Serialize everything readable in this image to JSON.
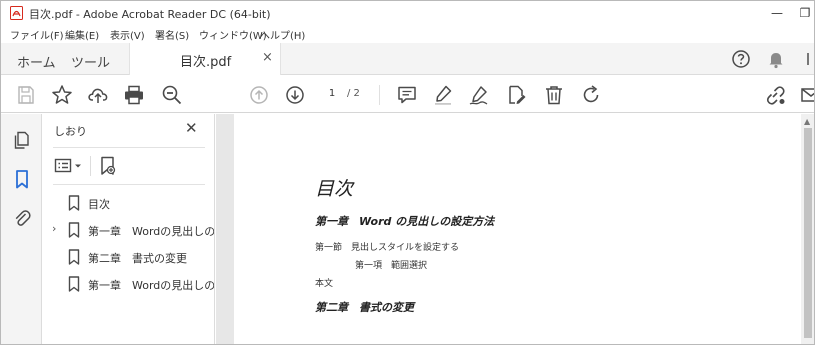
{
  "window": {
    "title": "目次.pdf - Adobe Acrobat Reader DC (64-bit)",
    "minimize_glyph": "—",
    "restore_glyph": "❐"
  },
  "menu": [
    "ファイル(F)",
    "編集(E)",
    "表示(V)",
    "署名(S)",
    "ウィンドウ(W)",
    "ヘルプ(H)"
  ],
  "tabs": {
    "home": "ホーム",
    "tools": "ツール",
    "document": "目次.pdf",
    "close_glyph": "×"
  },
  "toolbar": {
    "current_page": "1",
    "page_total": "/ 2"
  },
  "bookmarks_panel": {
    "title": "しおり",
    "close_glyph": "✕",
    "items": [
      {
        "label": "目次",
        "expandable": false
      },
      {
        "label": "第一章　Wordの見出しの設",
        "expandable": true
      },
      {
        "label": "第二章　書式の変更",
        "expandable": false
      },
      {
        "label": "第一章　Wordの見出しの設",
        "expandable": false
      }
    ]
  },
  "document": {
    "heading": "目次",
    "chapter1": "第一章　Word の見出しの設定方法",
    "section1": "第一節　見出しスタイルを設定する",
    "subsection1": "第一項　範囲選択",
    "body": "本文",
    "chapter2": "第二章　書式の変更"
  },
  "colors": {
    "accent_blue": "#2b6fd6",
    "icon_gray": "#4a4a4a",
    "pdf_red": "#d62a1e"
  }
}
